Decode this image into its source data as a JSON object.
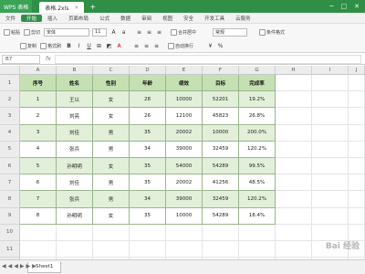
{
  "app": {
    "app_label": "WPS 表格",
    "doc_tab": "表格.2xls",
    "new_tab": "+",
    "window_controls": [
      "─",
      "□",
      "✕"
    ]
  },
  "menu": {
    "file": "文件",
    "items": [
      "开始",
      "插入",
      "页面布局",
      "公式",
      "数据",
      "审阅",
      "视图",
      "安全",
      "开发工具",
      "云服务"
    ],
    "active_index": 0
  },
  "toolbar": {
    "paste": "粘贴",
    "cut": "剪切",
    "copy": "复制",
    "format_painter": "格式刷",
    "font": "宋体",
    "font_size": "11",
    "merge": "合并居中",
    "wrap": "自动换行",
    "number_format": "常规",
    "conditional": "条件格式"
  },
  "formula": {
    "namebox": "B7",
    "fx": "fx"
  },
  "columns": [
    "A",
    "B",
    "C",
    "D",
    "E",
    "F",
    "G",
    "H",
    "I",
    "J"
  ],
  "rows": [
    "1",
    "2",
    "3",
    "4",
    "5",
    "6",
    "7",
    "8",
    "9",
    "10",
    "11",
    "12"
  ],
  "table": {
    "headers": [
      "序号",
      "姓名",
      "性别",
      "年龄",
      "绩效",
      "目标",
      "完成率"
    ],
    "rows": [
      [
        "1",
        "王以",
        "女",
        "28",
        "10000",
        "52201",
        "19.2%"
      ],
      [
        "2",
        "刘亮",
        "女",
        "26",
        "12100",
        "45823",
        "26.8%"
      ],
      [
        "3",
        "刘佳",
        "男",
        "35",
        "20002",
        "10000",
        "200.0%"
      ],
      [
        "4",
        "张兵",
        "男",
        "34",
        "39000",
        "32459",
        "120.2%"
      ],
      [
        "5",
        "孙明明",
        "女",
        "35",
        "54000",
        "54289",
        "99.5%"
      ],
      [
        "6",
        "刘佳",
        "男",
        "35",
        "20002",
        "41256",
        "48.5%"
      ],
      [
        "7",
        "张兵",
        "男",
        "34",
        "39000",
        "32459",
        "120.2%"
      ],
      [
        "8",
        "孙明明",
        "女",
        "35",
        "10000",
        "54289",
        "18.4%"
      ]
    ]
  },
  "sheet_tab": "Sheet1",
  "sheet_nav": "◀◀◀▶▶▶",
  "watermark": "Bai 经验"
}
